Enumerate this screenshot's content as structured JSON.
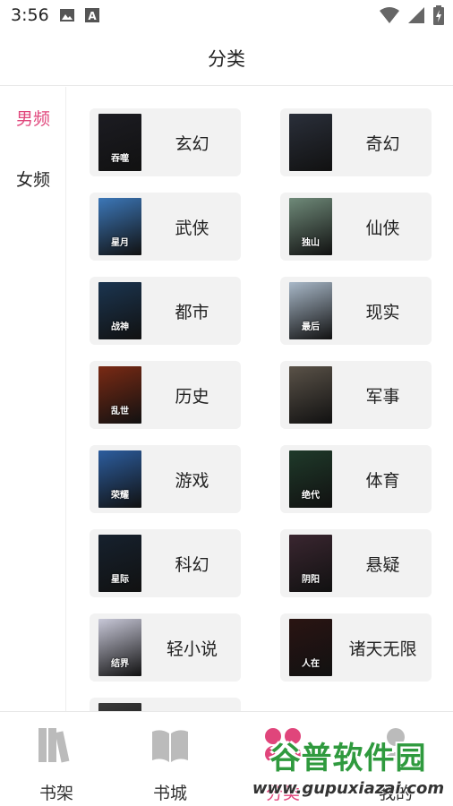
{
  "status_bar": {
    "time": "3:56",
    "left_icons": [
      "image-icon",
      "font-icon"
    ],
    "right_icons": [
      "wifi-icon",
      "signal-icon",
      "battery-icon"
    ]
  },
  "header": {
    "title": "分类"
  },
  "left_nav": {
    "items": [
      {
        "label": "男频",
        "active": true
      },
      {
        "label": "女频",
        "active": false
      }
    ]
  },
  "categories": [
    {
      "label": "玄幻",
      "cover_text": "吞噬",
      "cover_color": "#1c1c22"
    },
    {
      "label": "奇幻",
      "cover_text": "",
      "cover_color": "#2a2f3a"
    },
    {
      "label": "武侠",
      "cover_text": "星月",
      "cover_color": "#3c77b8"
    },
    {
      "label": "仙侠",
      "cover_text": "独山",
      "cover_color": "#6f8a79"
    },
    {
      "label": "都市",
      "cover_text": "战神",
      "cover_color": "#1b3550"
    },
    {
      "label": "现实",
      "cover_text": "最后",
      "cover_color": "#a8b8c8"
    },
    {
      "label": "历史",
      "cover_text": "乱世",
      "cover_color": "#7a2a14"
    },
    {
      "label": "军事",
      "cover_text": "",
      "cover_color": "#5a5248"
    },
    {
      "label": "游戏",
      "cover_text": "荣耀",
      "cover_color": "#2c5d9e"
    },
    {
      "label": "体育",
      "cover_text": "绝代",
      "cover_color": "#1f3a2a"
    },
    {
      "label": "科幻",
      "cover_text": "星际",
      "cover_color": "#16212e"
    },
    {
      "label": "悬疑",
      "cover_text": "阴阳",
      "cover_color": "#3a2630"
    },
    {
      "label": "轻小说",
      "cover_text": "结界",
      "cover_color": "#c8c8d8"
    },
    {
      "label": "诸天无限",
      "cover_text": "人在",
      "cover_color": "#2a1412"
    },
    {
      "label": "",
      "cover_text": "",
      "cover_color": "#3a3a3a"
    }
  ],
  "bottom_nav": {
    "tabs": [
      {
        "label": "书架",
        "icon": "bookshelf-icon",
        "active": false
      },
      {
        "label": "书城",
        "icon": "book-open-icon",
        "active": false
      },
      {
        "label": "分类",
        "icon": "category-icon",
        "active": true
      },
      {
        "label": "我的",
        "icon": "profile-icon",
        "active": false
      }
    ]
  },
  "watermark": {
    "main": "谷普软件园",
    "url": "www.gupuxiazai.com"
  },
  "colors": {
    "accent": "#e0457b",
    "card_bg": "#f2f2f2",
    "watermark_green": "#2f9a3e"
  }
}
